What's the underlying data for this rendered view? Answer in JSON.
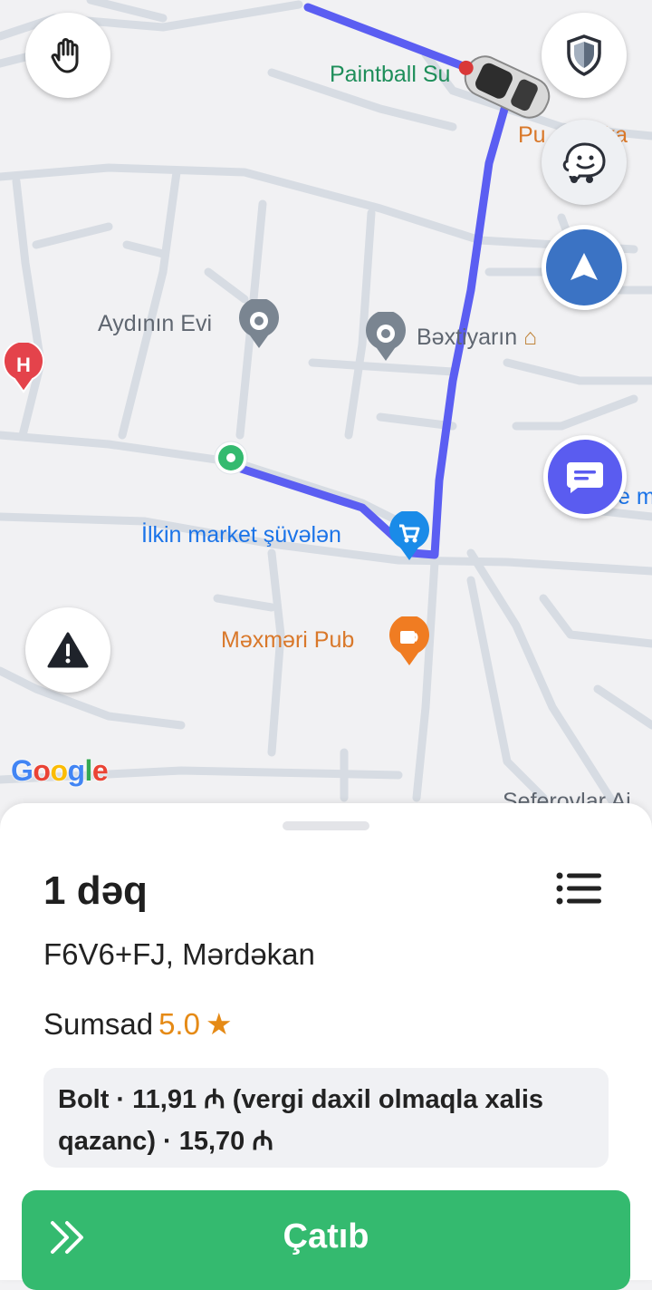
{
  "map": {
    "pois": {
      "paintball": "Paintball Su",
      "pub_top": "Pu",
      "pub_top_suffix": "ka",
      "aydinin_evi": "Aydının Evi",
      "bextiyarin": "Bəxtiyarın",
      "ilkin_market": "İlkin market şüvələn",
      "mexmeri_pub": "Məxməri Pub",
      "seferovlar": "Seferovlar Ai",
      "right_edge": "e m",
      "hospital_letter": "H"
    },
    "google_logo": [
      "G",
      "o",
      "o",
      "g",
      "l",
      "e"
    ],
    "colors": {
      "route": "#5b5ef2",
      "road": "#d5dae2",
      "accent_green": "#34ba6f",
      "rating_orange": "#e58a16"
    }
  },
  "controls": {
    "hand_icon": "hand-icon",
    "shield_icon": "shield-icon",
    "waze_icon": "waze-icon",
    "recenter_icon": "navigation-arrow-icon",
    "chat_icon": "chat-icon",
    "warning_icon": "warning-icon"
  },
  "trip": {
    "eta": "1 dəq",
    "address": "F6V6+FJ, Mərdəkan",
    "rider_name": "Sumsad",
    "rider_rating": "5.0",
    "star": "★",
    "fare_text": "Bolt · 11,91 ₼ (vergi daxil olmaqla xalis qazanc) · 15,70 ₼",
    "action_label": "Çatıb"
  }
}
